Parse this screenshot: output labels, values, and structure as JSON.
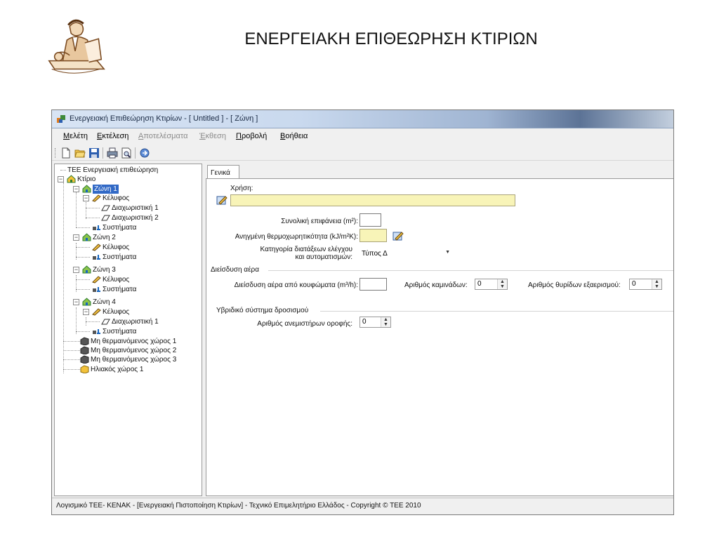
{
  "slide": {
    "title": "ΕΝΕΡΓΕΙΑΚΗ ΕΠΙΘΕΩΡΗΣΗ ΚΤΙΡΙΩΝ"
  },
  "window": {
    "title": "Ενεργειακή Επιθεώρηση Κτιρίων - [ Untitled ] - [ Ζώνη ]"
  },
  "menu": {
    "items": [
      {
        "label": "Μελέτη",
        "disabled": false
      },
      {
        "label": "Εκτέλεση",
        "disabled": false
      },
      {
        "label": "Αποτελέσματα",
        "disabled": true
      },
      {
        "label": "Έκθεση",
        "disabled": true
      },
      {
        "label": "Προβολή",
        "disabled": false
      },
      {
        "label": "Βοήθεια",
        "disabled": false
      }
    ]
  },
  "toolbar": {
    "buttons": [
      "new-file-icon",
      "open-folder-icon",
      "save-icon",
      "print-icon",
      "print-preview-icon",
      "calculate-icon"
    ]
  },
  "tree": {
    "root": "TEE Ενεργειακή επιθεώρηση",
    "building": "Κτίριο",
    "zone1": "Ζώνη 1",
    "zone1_envelope": "Κέλυφος",
    "zone1_partition1": "Διαχωριστική 1",
    "zone1_partition2": "Διαχωριστική 2",
    "zone1_systems": "Συστήματα",
    "zone2": "Ζώνη 2",
    "zone2_envelope": "Κέλυφος",
    "zone2_systems": "Συστήματα",
    "zone3": "Ζώνη 3",
    "zone3_envelope": "Κέλυφος",
    "zone3_systems": "Συστήματα",
    "zone4": "Ζώνη 4",
    "zone4_envelope": "Κέλυφος",
    "zone4_partition1": "Διαχωριστική 1",
    "zone4_systems": "Συστήματα",
    "unheated1": "Μη θερμαινόμενος χώρος 1",
    "unheated2": "Μη θερμαινόμενος χώρος 2",
    "unheated3": "Μη θερμαινόμενος χώρος 3",
    "solar1": "Ηλιακός χώρος 1"
  },
  "form": {
    "tab_label": "Γενικά",
    "use_label": "Χρήση:",
    "use_value": "",
    "total_area_label": "Συνολική επιφάνεια (m²):",
    "total_area_value": "",
    "heat_capacity_label": "Ανηγμένη θερμοχωρητικότητα (kJ/m²K):",
    "heat_capacity_value": "",
    "control_category_label_line1": "Κατηγορία διατάξεων ελέγχου",
    "control_category_label_line2": "και αυτοματισμών:",
    "control_category_value": "Τύπος Δ",
    "infiltration_group": "Διείσδυση αέρα",
    "infiltration_label": "Διείσδυση αέρα από κουφώματα (m³/h):",
    "infiltration_value": "",
    "chimneys_label": "Αριθμός καμινάδων:",
    "chimneys_value": "0",
    "vents_label": "Αριθμός θυρίδων εξαερισμού:",
    "vents_value": "0",
    "hybrid_group": "Υβριδικό σύστημα δροσισμού",
    "fans_label": "Αριθμός ανεμιστήρων οροφής:",
    "fans_value": "0"
  },
  "status": {
    "text": "Λογισμικό ΤΕΕ- ΚΕΝΑΚ - [Ενεργειακή Πιστοποίηση Κτιρίων] - Τεχνικό Επιμελητήριο Ελλάδος - Copyright © TEE 2010"
  },
  "colors": {
    "selection": "#3169c6",
    "input_yellow": "#f8f4b8",
    "window_bg": "#f0f0f0"
  }
}
